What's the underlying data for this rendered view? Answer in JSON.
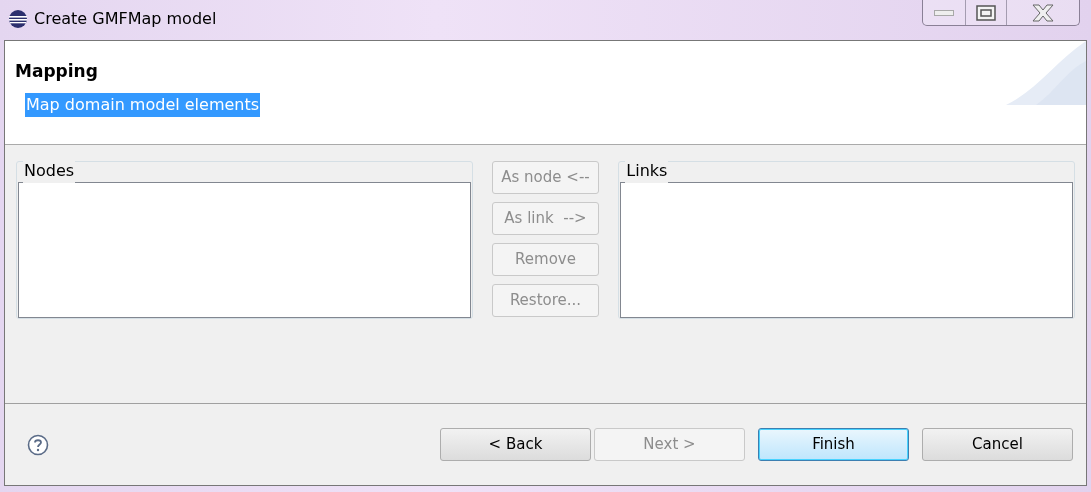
{
  "window": {
    "title": "Create GMFMap model"
  },
  "header": {
    "title": "Mapping",
    "message": "Map domain model elements",
    "message_selected": true
  },
  "nodes": {
    "label": "Nodes"
  },
  "links": {
    "label": "Links"
  },
  "actions": [
    {
      "label": "As node <--",
      "disabled": true
    },
    {
      "label": "As link  -->",
      "disabled": true
    },
    {
      "label": "Remove",
      "disabled": true
    },
    {
      "label": "Restore...",
      "disabled": true
    }
  ],
  "buttons": [
    {
      "label": "< Back",
      "disabled": false,
      "default": false
    },
    {
      "label": "Next >",
      "disabled": true,
      "default": false
    },
    {
      "label": "Finish",
      "disabled": false,
      "default": true
    },
    {
      "label": "Cancel",
      "disabled": false,
      "default": false
    }
  ]
}
